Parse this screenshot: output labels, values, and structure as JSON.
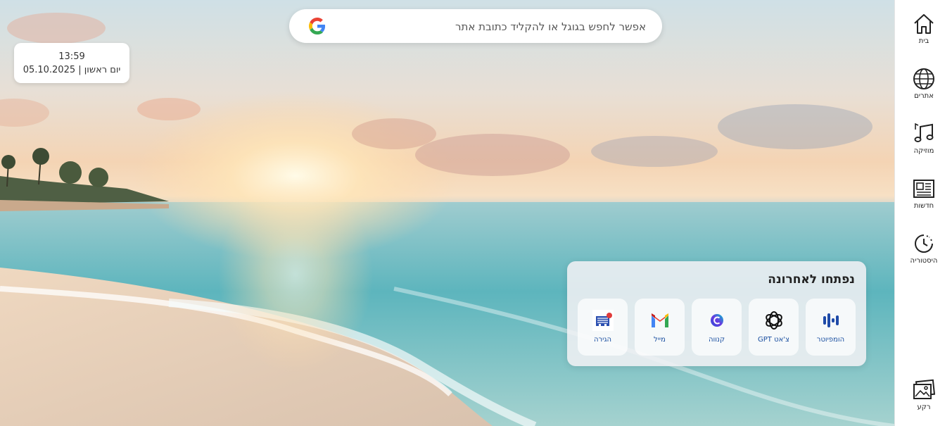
{
  "search": {
    "placeholder": "אפשר לחפש בגוגל או להקליד כתובת אתר"
  },
  "clock": {
    "time": "13:59",
    "date": "יום ראשון | 05.10.2025"
  },
  "sidebar": {
    "items": [
      {
        "label": "בית",
        "icon": "home-icon"
      },
      {
        "label": "אתרים",
        "icon": "globe-icon"
      },
      {
        "label": "מוזיקה",
        "icon": "music-icon"
      },
      {
        "label": "חדשות",
        "icon": "news-icon"
      },
      {
        "label": "היסטוריה",
        "icon": "history-icon"
      }
    ],
    "background": {
      "label": "רקע",
      "icon": "image-icon"
    }
  },
  "recent": {
    "title": "נפתחו לאחרונה",
    "tiles": [
      {
        "label": "הומפיוטר",
        "icon": "homepiter-icon"
      },
      {
        "label": "צ'אט GPT",
        "icon": "chatgpt-icon"
      },
      {
        "label": "קנווה",
        "icon": "canva-icon"
      },
      {
        "label": "מייל",
        "icon": "gmail-icon"
      },
      {
        "label": "הגירה",
        "icon": "migration-icon"
      }
    ]
  },
  "colors": {
    "tile_label": "#1a4fa0",
    "sidebar_bg": "#ffffff"
  }
}
